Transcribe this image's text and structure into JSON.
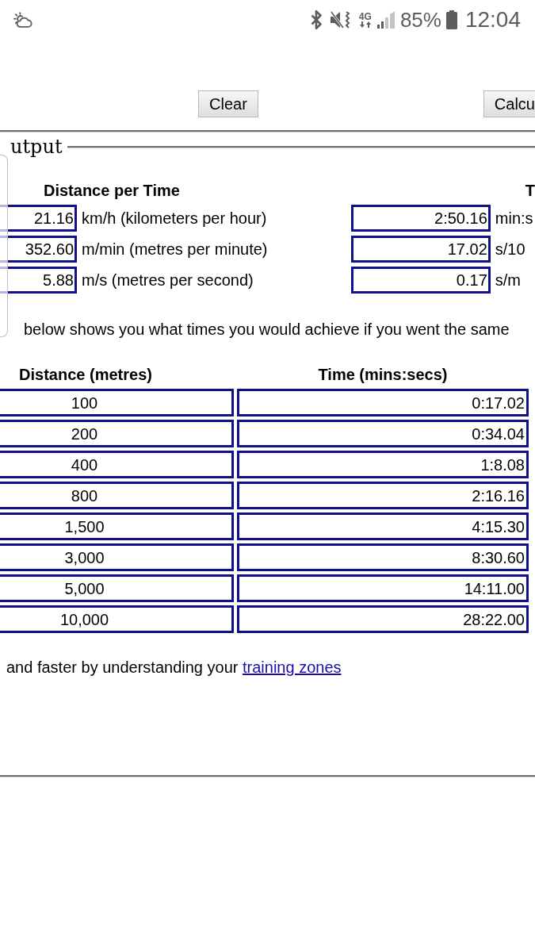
{
  "status_bar": {
    "network_type": "4G",
    "battery": "85%",
    "time": "12:04"
  },
  "buttons": [
    {
      "label": "Clear"
    },
    {
      "label": "Calcu"
    }
  ],
  "output": {
    "legend": "utput",
    "speed": {
      "heading": "Distance per Time",
      "rows": [
        {
          "value": "21.16",
          "unit": "km/h (kilometers per hour)"
        },
        {
          "value": "352.60",
          "unit": "m/min (metres per minute)"
        },
        {
          "value": "5.88",
          "unit": "m/s (metres per second)"
        }
      ]
    },
    "pace": {
      "heading": "T",
      "rows": [
        {
          "value": "2:50.16",
          "unit": "min:s"
        },
        {
          "value": "17.02",
          "unit": "s/10"
        },
        {
          "value": "0.17",
          "unit": "s/m"
        }
      ]
    },
    "note": "below shows you what times you would achieve if you went the same",
    "splits": {
      "columns": [
        "Distance (metres)",
        "Time (mins:secs)"
      ],
      "rows": [
        {
          "distance": "100",
          "time": "0:17.02"
        },
        {
          "distance": "200",
          "time": "0:34.04"
        },
        {
          "distance": "400",
          "time": "1:8.08"
        },
        {
          "distance": "800",
          "time": "2:16.16"
        },
        {
          "distance": "1,500",
          "time": "4:15.30"
        },
        {
          "distance": "3,000",
          "time": "8:30.60"
        },
        {
          "distance": "5,000",
          "time": "14:11.00"
        },
        {
          "distance": "10,000",
          "time": "28:22.00"
        }
      ]
    },
    "footer": {
      "text": "and faster by understanding your",
      "link": "training zones"
    }
  }
}
